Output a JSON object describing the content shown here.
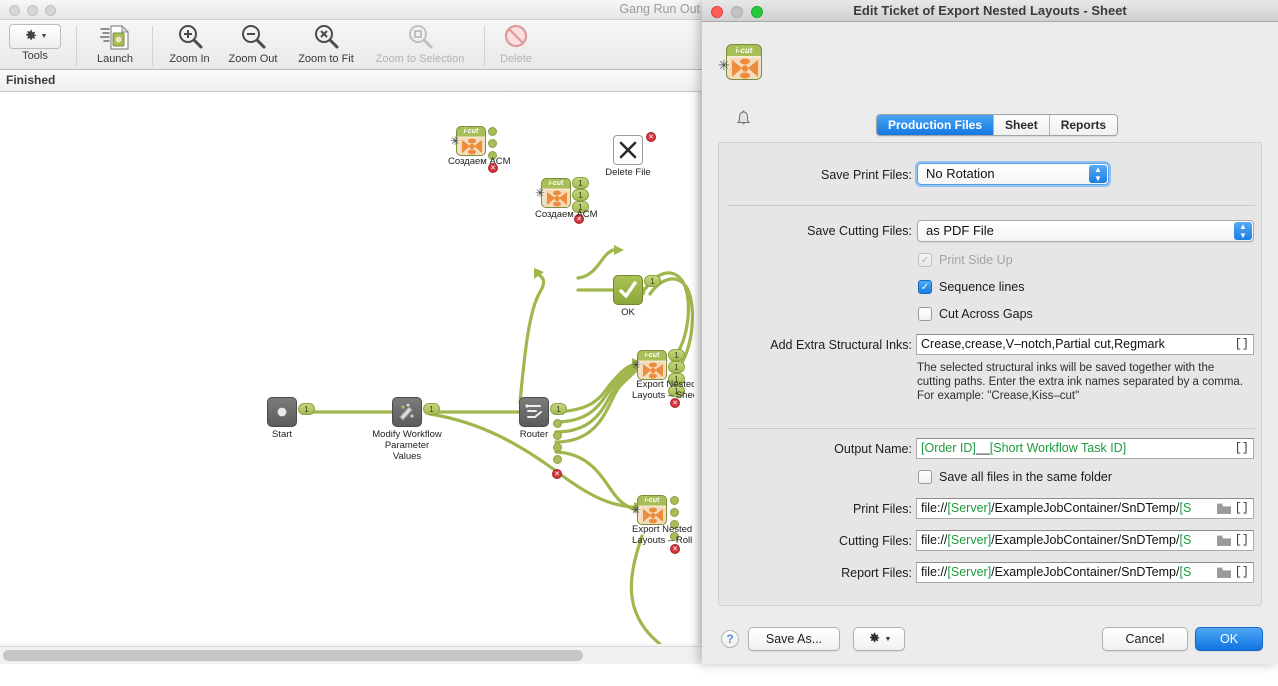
{
  "app": {
    "title": "Gang Run Out",
    "status": "Finished",
    "toolbar": [
      {
        "label": "Tools",
        "icon": "gear-icon",
        "disabled": false
      },
      {
        "label": "Launch",
        "icon": "launch-icon",
        "disabled": false
      },
      {
        "label": "Zoom In",
        "icon": "zoom-in-icon",
        "disabled": false
      },
      {
        "label": "Zoom Out",
        "icon": "zoom-out-icon",
        "disabled": false
      },
      {
        "label": "Zoom to Fit",
        "icon": "zoom-to-fit-icon",
        "disabled": false
      },
      {
        "label": "Zoom to Selection",
        "icon": "zoom-to-selection-icon",
        "disabled": true
      },
      {
        "label": "Delete",
        "icon": "delete-icon",
        "disabled": true
      }
    ]
  },
  "canvas": {
    "nodes": [
      {
        "name": "sozdaem-acm-top",
        "label": "Создаем ACM",
        "type": "icut"
      },
      {
        "name": "sozdaem-acm-mid",
        "label": "Создаем ACM",
        "type": "icut"
      },
      {
        "name": "delete-file",
        "label": "Delete File",
        "type": "white"
      },
      {
        "name": "ok",
        "label": "OK",
        "type": "green"
      },
      {
        "name": "start",
        "label": "Start",
        "type": "gray"
      },
      {
        "name": "modify-workflow-parameter-values",
        "label": "Modify Workflow\nParameter\nValues",
        "type": "gray"
      },
      {
        "name": "router",
        "label": "Router",
        "type": "gray"
      },
      {
        "name": "export-nested-layouts-sheet",
        "label": "Export Nested\nLayouts – Sheet",
        "type": "icut"
      },
      {
        "name": "export-nested-layouts-roll",
        "label": "Export Nested\nLayouts – Roll",
        "type": "icut"
      }
    ],
    "node_labels": {
      "sozdaem_acm": "Создаем ACM",
      "delete_file": "Delete File",
      "ok": "OK",
      "start": "Start",
      "modify_line1": "Modify Workflow",
      "modify_line2": "Parameter",
      "modify_line3": "Values",
      "router": "Router",
      "export_sheet_line1": "Export Nested",
      "export_sheet_line2": "Layouts – Sheet",
      "export_roll_line1": "Export Nested",
      "export_roll_line2": "Layouts – Roll"
    },
    "icut_badge": "i-cut",
    "pill_count": "1"
  },
  "dialog": {
    "title": "Edit Ticket of Export Nested Layouts - Sheet",
    "icon": "i-cut",
    "tabs": [
      {
        "label": "Production Files",
        "active": true
      },
      {
        "label": "Sheet",
        "active": false
      },
      {
        "label": "Reports",
        "active": false
      }
    ],
    "fields": {
      "save_print_files": {
        "label": "Save Print Files:",
        "value": "No Rotation"
      },
      "save_cutting_files": {
        "label": "Save Cutting Files:",
        "value": "as PDF File"
      },
      "print_side_up": {
        "label": "Print Side Up",
        "checked": true,
        "disabled": true
      },
      "sequence_lines": {
        "label": "Sequence lines",
        "checked": true,
        "disabled": false
      },
      "cut_across_gaps": {
        "label": "Cut Across Gaps",
        "checked": false,
        "disabled": false
      },
      "structural_inks": {
        "label": "Add Extra Structural Inks:",
        "value": "Crease,crease,V–notch,Partial cut,Regmark",
        "brackets": "[]",
        "help_line1": "The selected structural inks will be saved together with the",
        "help_line2": "cutting paths. Enter the extra ink names separated by a comma.",
        "help_line3": "For example: \"Crease,Kiss–cut\""
      },
      "output_name": {
        "label": "Output Name:",
        "value_token_1": "[Order ID]",
        "value_separator": "__",
        "value_token_2": "[Short Workflow Task ID]",
        "brackets": "[]"
      },
      "same_folder": {
        "label": "Save all files in the same folder",
        "checked": false
      },
      "print_files": {
        "label": "Print Files:",
        "prefix": "file://",
        "token": "[Server]",
        "path": "/ExampleJobContainer/SnDTemp/",
        "suffix": "[S",
        "brackets": "[]"
      },
      "cutting_files": {
        "label": "Cutting Files:",
        "prefix": "file://",
        "token": "[Server]",
        "path": "/ExampleJobContainer/SnDTemp/",
        "suffix": "[S",
        "brackets": "[]"
      },
      "report_files": {
        "label": "Report Files:",
        "prefix": "file://",
        "token": "[Server]",
        "path": "/ExampleJobContainer/SnDTemp/",
        "suffix": "[S",
        "brackets": "[]"
      }
    },
    "footer": {
      "help": "?",
      "save_as": "Save As...",
      "gear": "gear-icon",
      "cancel": "Cancel",
      "ok": "OK"
    }
  },
  "colors": {
    "accent_blue": "#1478e0",
    "green_token": "#1e9b3e",
    "wire_green": "#9fb74c",
    "error_red": "#d3353a"
  }
}
